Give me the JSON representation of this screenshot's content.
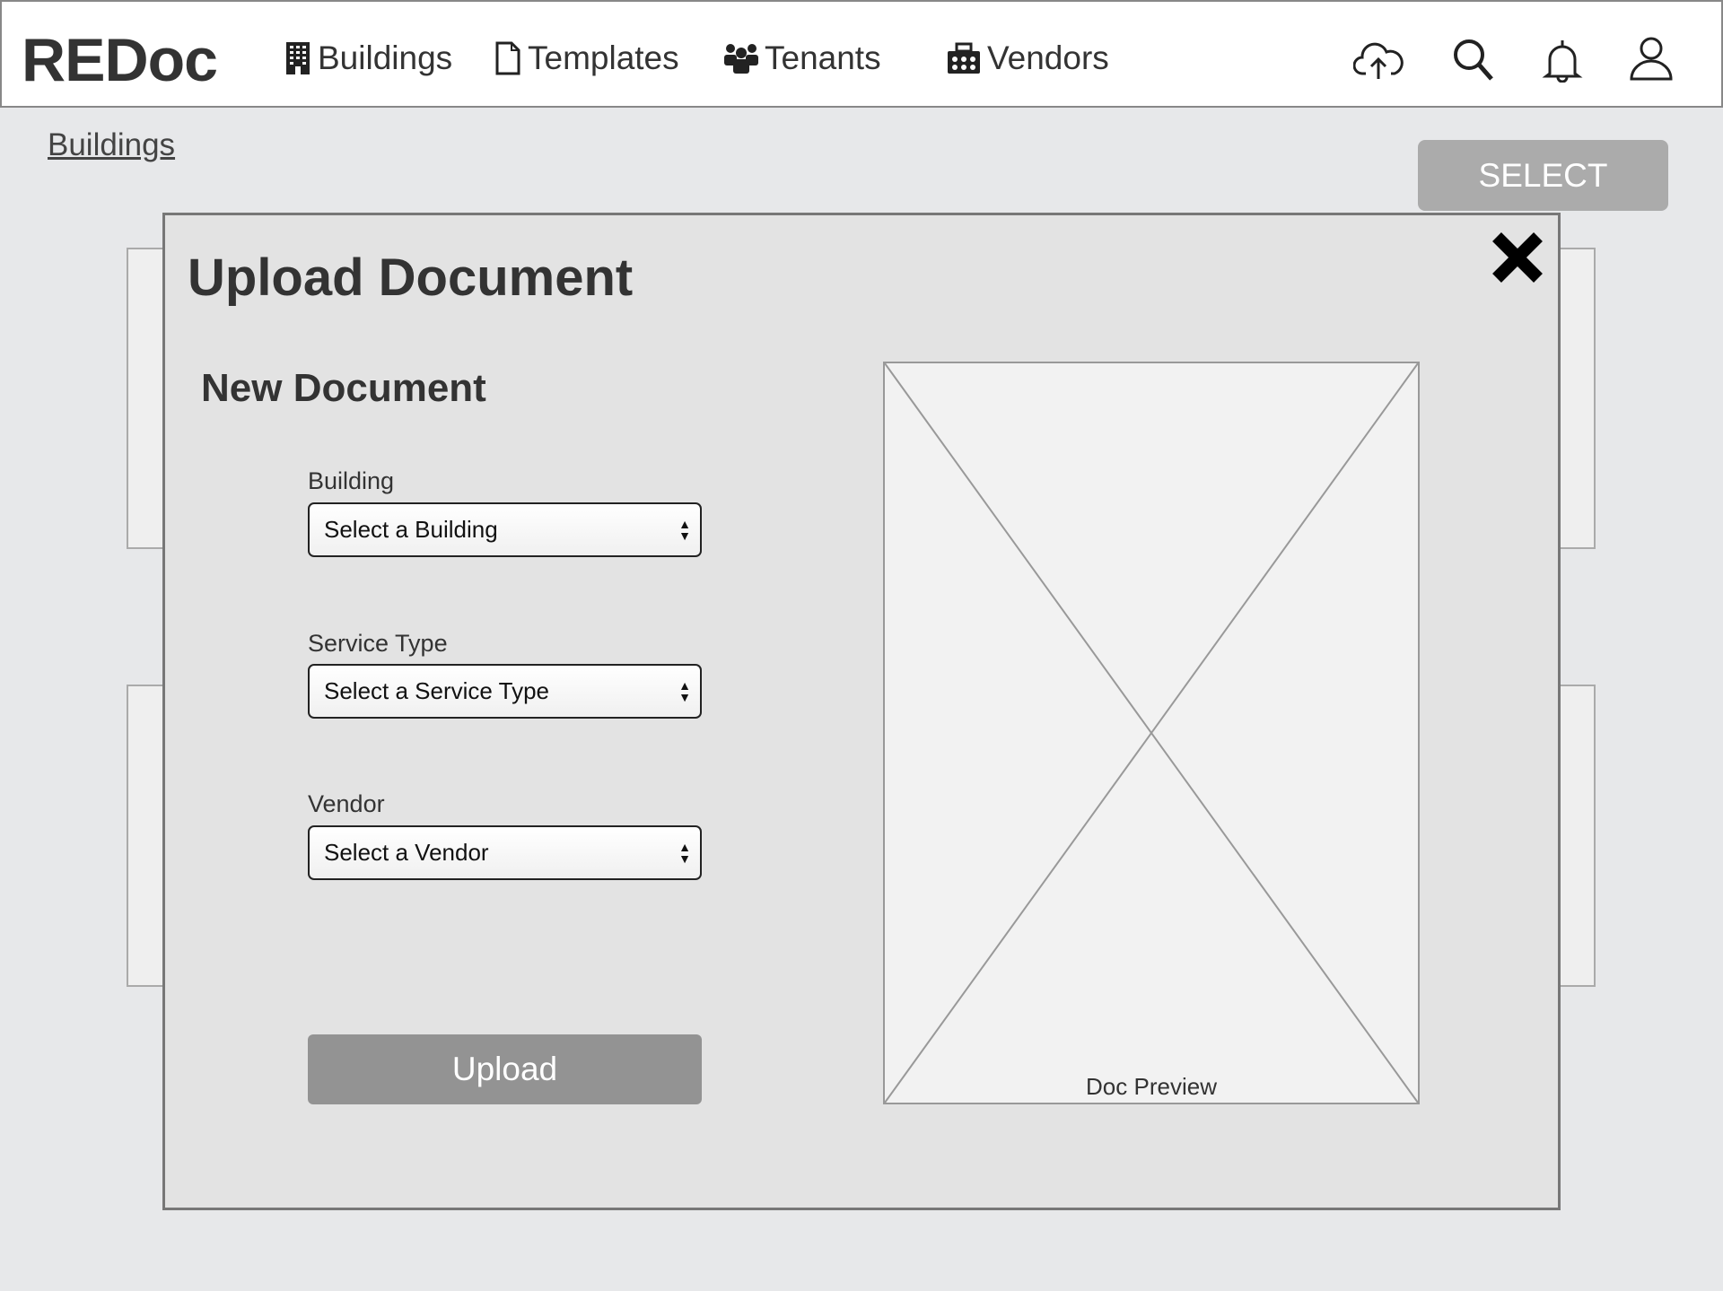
{
  "header": {
    "logo": "REDoc",
    "nav": [
      {
        "label": "Buildings",
        "icon": "building-icon"
      },
      {
        "label": "Templates",
        "icon": "document-icon"
      },
      {
        "label": "Tenants",
        "icon": "people-icon"
      },
      {
        "label": "Vendors",
        "icon": "toolbox-icon"
      }
    ],
    "actions": [
      "cloud-upload-icon",
      "search-icon",
      "bell-icon",
      "user-icon"
    ]
  },
  "breadcrumb": "Buildings",
  "select_button": "SELECT",
  "modal": {
    "title": "Upload Document",
    "subtitle": "New Document",
    "fields": [
      {
        "label": "Building",
        "value": "Select a Building"
      },
      {
        "label": "Service Type",
        "value": "Select a Service Type"
      },
      {
        "label": "Vendor",
        "value": "Select a Vendor"
      }
    ],
    "upload_label": "Upload",
    "preview_caption": "Doc Preview"
  }
}
